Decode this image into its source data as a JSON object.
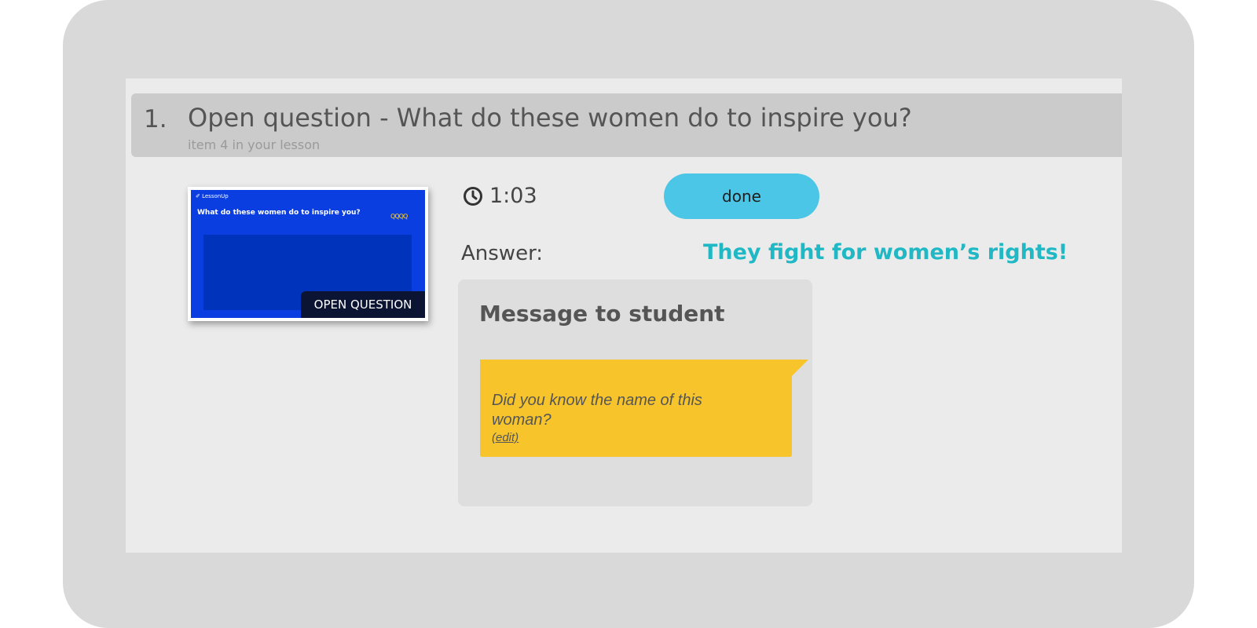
{
  "question": {
    "number": "1.",
    "title": "Open question - What do these women do to inspire you?",
    "subtitle": "item 4 in your lesson"
  },
  "thumbnail": {
    "brand": "✐ LessonUp",
    "title": "What do these women do to inspire you?",
    "badge": "OPEN QUESTION"
  },
  "stats": {
    "clock_icon": "clock-icon",
    "time": "1:03",
    "done_label": "done"
  },
  "answer": {
    "label": "Answer:",
    "value": "They fight for women’s rights!"
  },
  "message": {
    "title": "Message to student",
    "text": "Did you know the name of this woman?",
    "edit_label": "(edit)"
  },
  "colors": {
    "accent_button": "#4bc6e6",
    "answer_text": "#1fb8c4",
    "sticky_note": "#f7c52b",
    "slide_blue": "#0a3ee0"
  }
}
